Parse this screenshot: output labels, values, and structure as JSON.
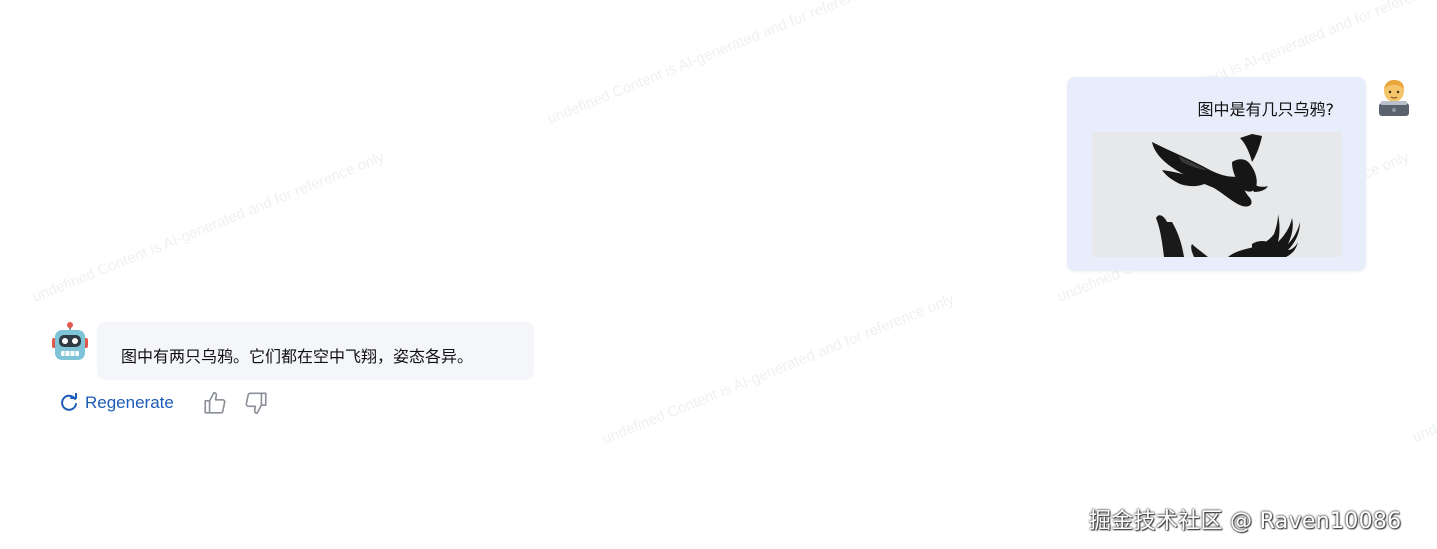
{
  "watermark": {
    "text": "undefined Content is AI-generated and for reference only"
  },
  "user_message": {
    "text": "图中是有几只乌鸦?",
    "avatar_icon": "man-technologist-icon",
    "image_icon": "crows-photo"
  },
  "bot_message": {
    "text": "图中有两只乌鸦。它们都在空中飞翔，姿态各异。",
    "avatar_icon": "robot-icon"
  },
  "actions": {
    "regenerate_label": "Regenerate",
    "regenerate_icon": "refresh-icon",
    "like_icon": "thumbs-up-icon",
    "dislike_icon": "thumbs-down-icon",
    "accent_color": "#1c5bb8"
  },
  "footer": {
    "credit": "掘金技术社区 @ Raven10086"
  }
}
